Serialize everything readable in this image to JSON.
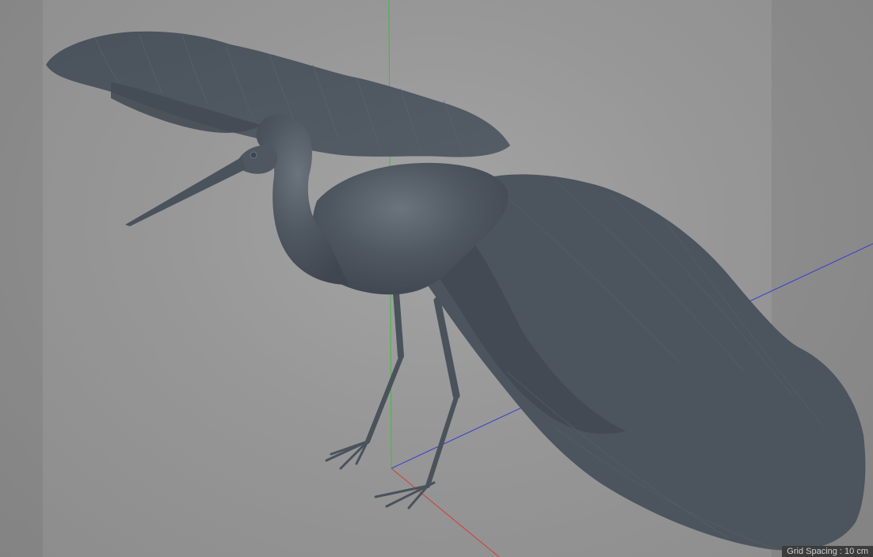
{
  "viewport": {
    "object_name": "heron-model",
    "grid_spacing_label": "Grid Spacing : 10 cm"
  },
  "colors": {
    "background": "#999999",
    "model": "#4e5660",
    "axis_x": "#d23b3b",
    "axis_y": "#3bbf3b",
    "axis_z": "#3b3bd2",
    "hud_bg": "#3c3c3c"
  }
}
